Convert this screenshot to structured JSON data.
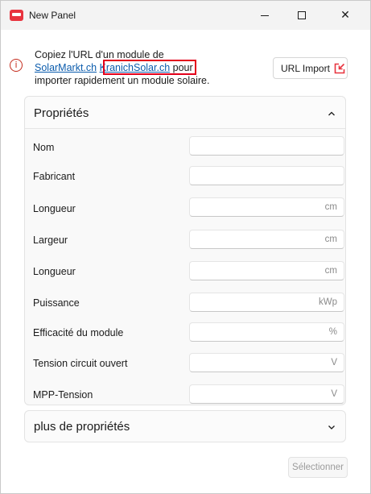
{
  "window": {
    "title": "New Panel",
    "minimize_glyph": "—",
    "maximize_glyph": "□",
    "close_glyph": "✕"
  },
  "info": {
    "icon": "info-icon",
    "icon_glyph": "i",
    "line1": "Copiez l'URL d'un module de",
    "link1": "SolarMarkt.ch",
    "link2": "KranichSolar.ch",
    "after_links": " pour",
    "line3": "importer rapidement un module solaire."
  },
  "url_import": {
    "label": "URL Import",
    "icon": "external-import-icon",
    "accent": "#e8343f"
  },
  "properties": {
    "title": "Propriétés",
    "rows": [
      {
        "label": "Nom",
        "unit": ""
      },
      {
        "label": "Fabricant",
        "unit": ""
      },
      {
        "label": "Longueur",
        "unit": "cm"
      },
      {
        "label": "Largeur",
        "unit": "cm"
      },
      {
        "label": "Longueur",
        "unit": "cm"
      },
      {
        "label": "Puissance",
        "unit": "kWp"
      },
      {
        "label": "Efficacité du module",
        "unit": "%"
      },
      {
        "label": "Tension circuit ouvert",
        "unit": "V"
      },
      {
        "label": "MPP-Tension",
        "unit": "V"
      }
    ]
  },
  "more": {
    "title": "plus de propriétés"
  },
  "actions": {
    "select_label": "Sélectionner"
  },
  "colors": {
    "link": "#0b5cad",
    "error": "#c42b1c",
    "highlight": "#e3001b"
  }
}
